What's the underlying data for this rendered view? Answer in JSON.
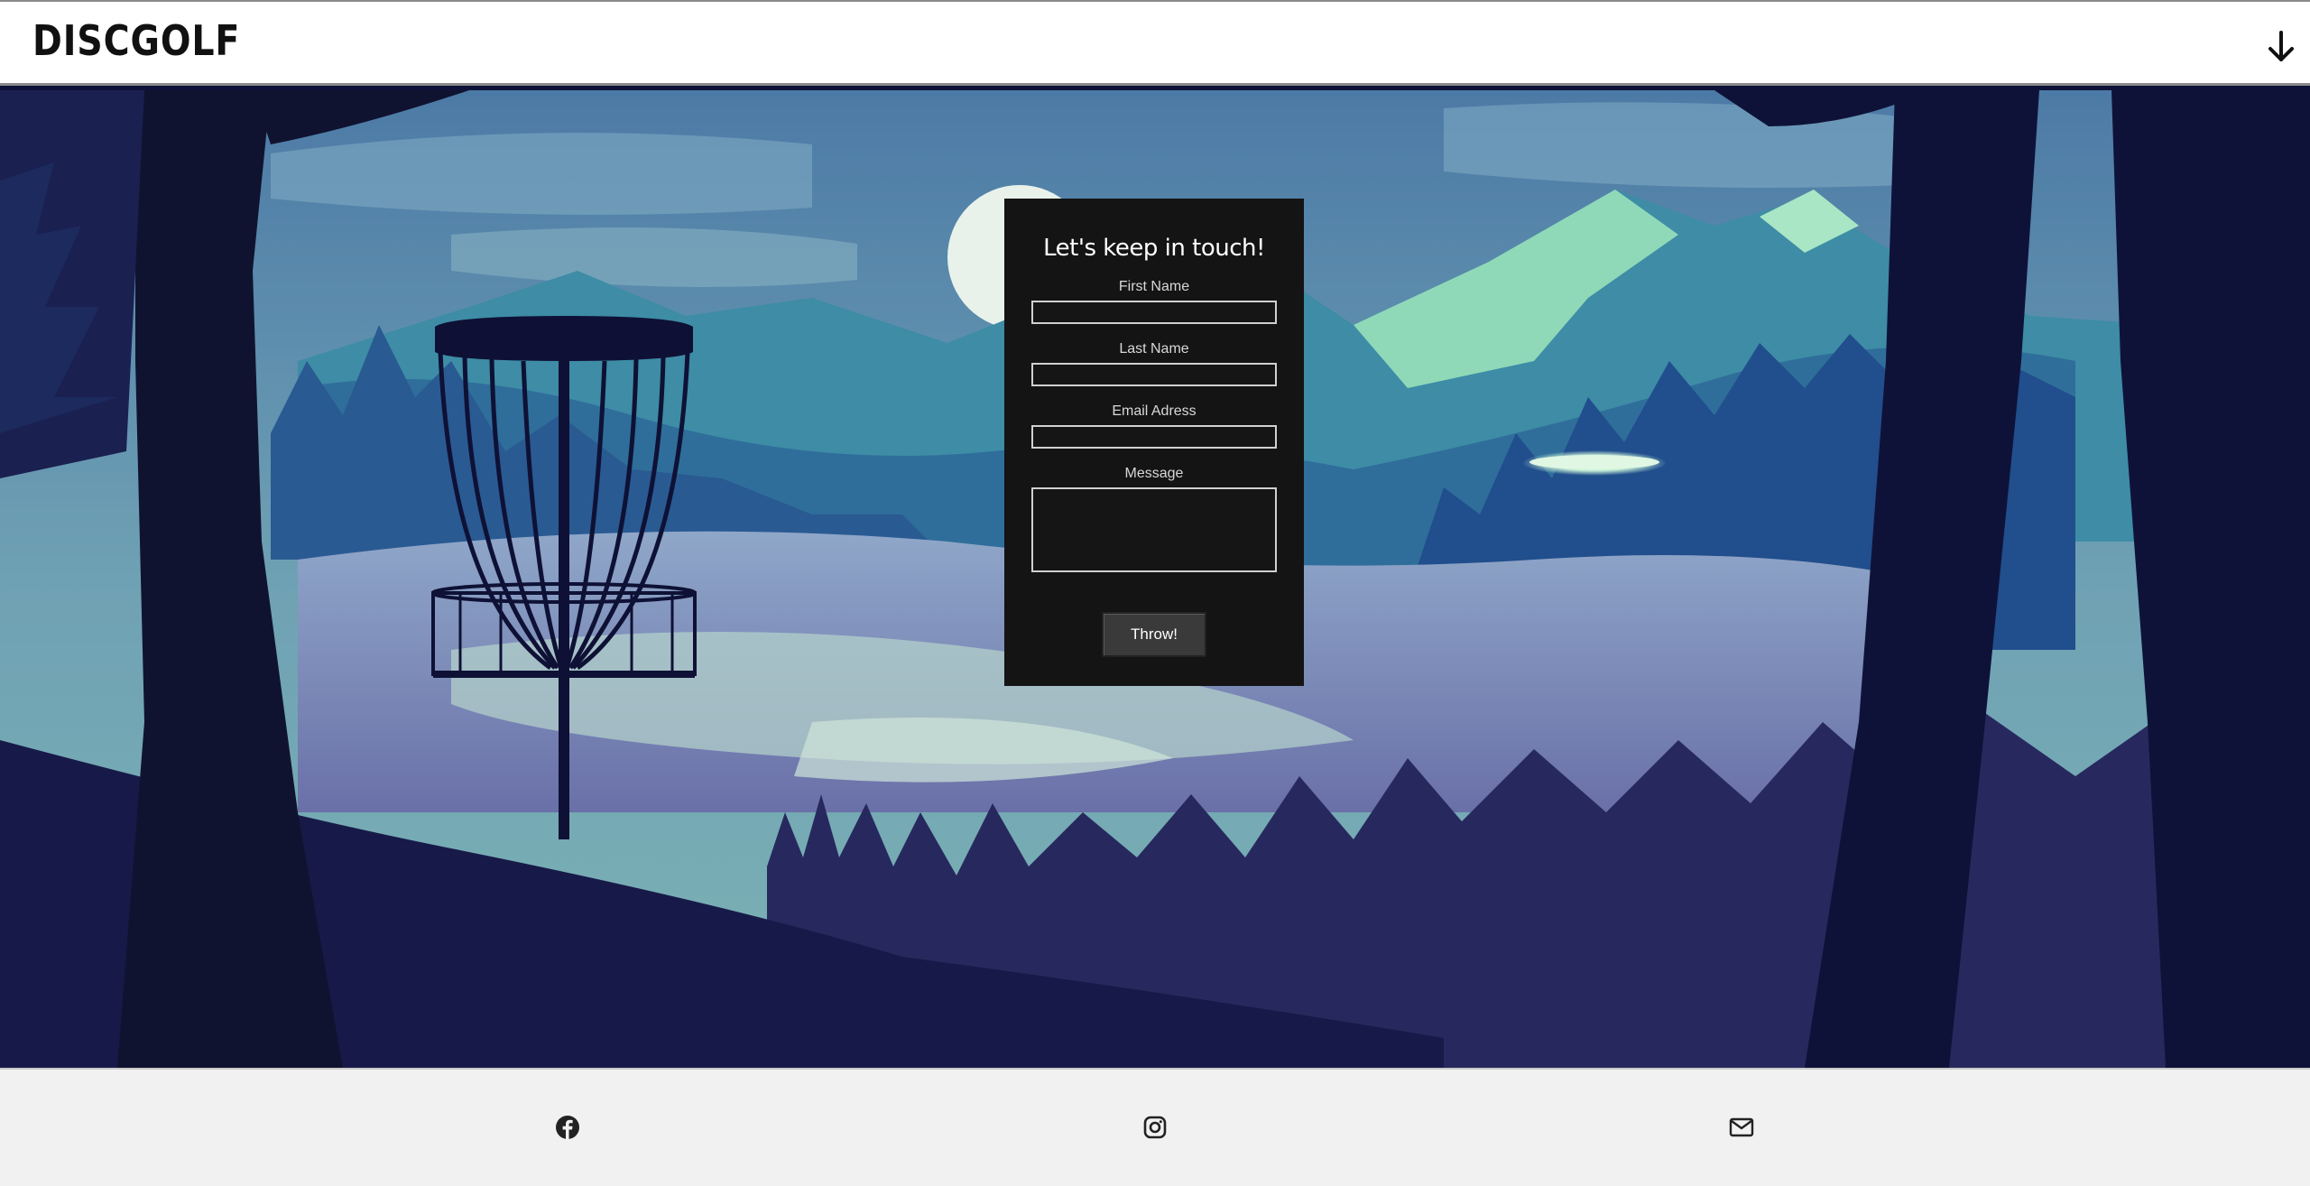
{
  "header": {
    "logo": "DISCGOLF",
    "scroll_icon": "arrow-down-icon"
  },
  "form": {
    "title": "Let's keep in touch!",
    "first_name_label": "First Name",
    "first_name_value": "",
    "last_name_label": "Last Name",
    "last_name_value": "",
    "email_label": "Email Adress",
    "email_value": "",
    "message_label": "Message",
    "message_value": "",
    "submit_label": "Throw!"
  },
  "footer": {
    "icons": [
      "facebook-icon",
      "instagram-icon",
      "mail-icon"
    ]
  },
  "colors": {
    "form_bg": "#141414",
    "footer_bg": "#f1f1f1",
    "header_bg": "#ffffff"
  }
}
